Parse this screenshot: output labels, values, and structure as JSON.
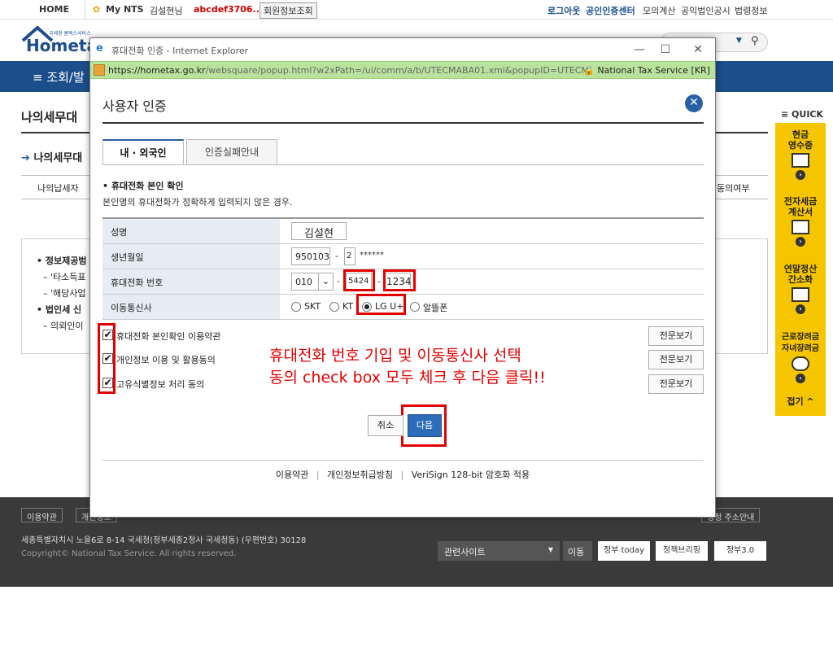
{
  "topbar": {
    "home": "HOME",
    "mynts": "My NTS",
    "user_name": "김설현님",
    "user_id": "abcdef3706...",
    "member_info": "회원정보조회",
    "logout": "로그아웃",
    "cert_center": "공인인증센터",
    "mock_calc": "모의계산",
    "corp_notice": "공익법인공시",
    "law_info": "법령정보"
  },
  "logo": {
    "text": "Hometax",
    "sub": "국세청 홈택스서비스"
  },
  "navbar": {
    "label": "≡  조회/발"
  },
  "bg": {
    "title": "나의세무대",
    "sub": "나의세무대",
    "tab_left": "나의납세자",
    "tab_right": "동의여부",
    "info": [
      "• 정보제공범",
      "– '타소득표",
      "– '해당사업",
      "• 법인세 신",
      "– 의뢰인이"
    ]
  },
  "quick": {
    "title": "≡ QUICK",
    "items": [
      {
        "label": "현금\n영수증",
        "icon": "receipt-icon"
      },
      {
        "label": "전자세금\n계산서",
        "icon": "invoice-icon"
      },
      {
        "label": "연말정산\n간소화",
        "icon": "document-icon"
      },
      {
        "label": "근로장려금\n자녀장려금",
        "icon": "heart-hand-icon"
      }
    ],
    "fold": "접기 ^"
  },
  "footer": {
    "terms": "이용약관",
    "privacy": "개인정보",
    "address_guide": "행정 주소안내",
    "address": "세종특별자치시 노을6로 8-14 국세청(정부세종2청사 국세청동) (우편번호) 30128",
    "copyright": "Copyright© National Tax Service. All rights reserved.",
    "related_site": "관련사이트",
    "go": "이동",
    "logos": [
      "정부 today",
      "정책브리핑",
      "정부3.0"
    ]
  },
  "window": {
    "title": "휴대전화 인증 - Internet Explorer",
    "url_main": "https://hometax.go.kr",
    "url_rest": "/websquare/popup.html?w2xPath=/ui/comm/a/b/UTECMABA01.xml&popupID=UTECMABA01&w2...",
    "security": "National Tax Service [KR]"
  },
  "dialog": {
    "title": "사용자 인증",
    "tabs": [
      "내 · 외국인",
      "인증실패안내"
    ],
    "section_title": "• 휴대전화 본인 확인",
    "section_desc": "본인명의 휴대전화가 정확하게 입력되지 않은 경우.",
    "form": {
      "name_label": "성명",
      "name_value": "김설현",
      "birth_label": "생년월일",
      "birth_value": "950103",
      "gender_digit": "2",
      "masked": "******",
      "phone_label": "휴대전화 번호",
      "phone_prefix": "010",
      "phone_mid": "5424",
      "phone_last": "1234",
      "carrier_label": "이동통신사",
      "carriers": [
        "SKT",
        "KT",
        "LG U+",
        "알뜰폰"
      ],
      "selected_carrier": "LG U+"
    },
    "agreements": [
      {
        "label": "휴대전화 본인확인 이용약관",
        "checked": true
      },
      {
        "label": "개인정보 이용 및 활용동의",
        "checked": true
      },
      {
        "label": "고유식별정보 처리 동의",
        "checked": true
      }
    ],
    "view_label": "전문보기",
    "annotation_line1": "휴대전화 번호 기입 및 이동통신사 선택",
    "annotation_line2": "동의 check box 모두 체크 후 다음 클릭!!",
    "cancel": "취소",
    "next": "다음",
    "footer_links": [
      "이용약관",
      "개인정보취급방침",
      "VeriSign 128-bit 암호화 적용"
    ]
  },
  "colors": {
    "accent": "#2860a6",
    "highlight": "#e30000",
    "nav": "#1c4e8c",
    "quick": "#f5c500"
  }
}
